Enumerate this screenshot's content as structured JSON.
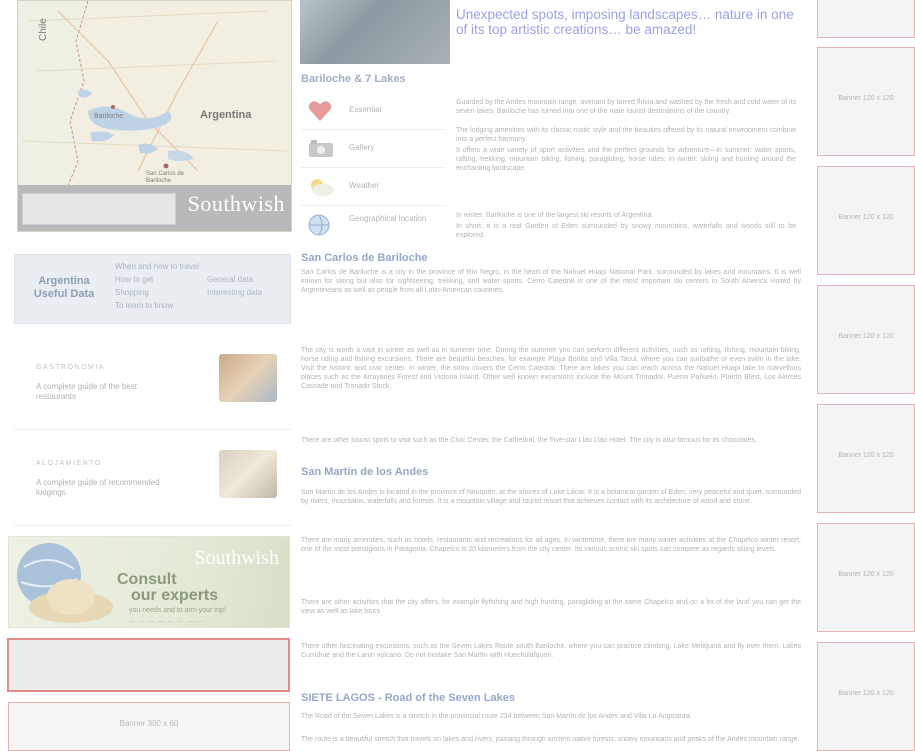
{
  "map": {
    "country_chile": "Chile",
    "country_argentina": "Argentina",
    "city_bariloche": "Bariloche",
    "city_san_carlos": "San Carlos de Bariloche",
    "logo": "Southwish"
  },
  "argentina_useful_data": {
    "title": "Argentina Useful Data",
    "links": [
      "When and how to travel",
      "General data",
      "How to get",
      "Shopping",
      "Interesting data",
      "To learn to know"
    ]
  },
  "promos": [
    {
      "title": "GASTRONOMIA",
      "description": "A complete guide of the best restaurants"
    },
    {
      "title": "ALOJAMIENTO",
      "description": "A complete guide of recommended lodgings"
    }
  ],
  "consult": {
    "logo": "Southwish",
    "line1": "Consult",
    "line2": "our experts",
    "tagline": "you needs and to arm your trip!",
    "sub": "— — — — — — — —"
  },
  "left_banner": {
    "text": "Banner 300 x 60"
  },
  "hero": {
    "text": "Unexpected spots, imposing landscapes… nature in one of its top artistic creations… be amazed!"
  },
  "bariloche": {
    "heading": "Bariloche & 7 Lakes",
    "icon_rows": [
      {
        "icon": "heart-icon",
        "label": "Essential"
      },
      {
        "icon": "camera-icon",
        "label": "Gallery"
      },
      {
        "icon": "cloud-icon",
        "label": "Weather"
      },
      {
        "icon": "globe-icon",
        "label": "Geographical location"
      }
    ],
    "paragraphs": [
      "Guarded by the Andes mountain range, avenant by tarred fluvia and washed by the fresh and cold water of its seven lakes, Bariloche has turned into one of the main tourist destinations of the country.",
      "The lodging amenities with its classic rustic style and the beauties offered by its natural environment combine into a perfect harmony.",
      "It offers a wide variety of sport activities and the perfect grounds for adventure—in summer: water sports, rafting, trekking, mountain biking, fishing, paragliding, horse rides; in winter: skiing and hunting around the enchanting landscape.",
      "In winter, Bariloche is one of the largest ski resorts of Argentina.",
      "In short: it is a real Garden of Eden surrounded by snowy mountains, waterfalls and woods still to be explored."
    ]
  },
  "san_carlos": {
    "heading": "San Carlos de Bariloche",
    "paragraphs": [
      "San Carlos de Bariloche is a city in the province of Río Negro, in the heart of the Nahuel Huapi National Park, surrounded by lakes and mountains. It is well known for skiing but also for sightseeing, trekking, and water sports. Cerro Catedral is one of the most important ski centers in South America visited by Argentineans as well as people from all Latin-American countries.",
      "The city is worth a visit in winter as well as in summer time. During the summer you can perform different activities, such as rafting, fishing, mountain biking, horse riding and fishing excursions. There are beautiful beaches, for example Playa Bonita and Villa Tacul, where you can sunbathe or even swim in the lake. Visit the historic and civic center. In winter, the snow covers the Cerro Catedral. There are lakes you can reach across the Nahuel Huapi lake to marvellous places such as the Arrayanes Forest and Victoria Island. Other well known excursions include the Mount Tronador, Puerto Pañuelo, Puerto Blest, Los Alerces Cascade and Tronadir Stock.",
      "There are other tourist spots to visit such as the Civic Center, the Cathedral, the Five-star Llao Llao Hotel. The city is also famous for its chocolates."
    ]
  },
  "san_martin": {
    "heading": "San Martín de los Andes",
    "paragraphs": [
      "San Martín de los Andes is located in the province of Neuquén, at the shores of Lake Lácar. It is a botanical garden of Eden, very peaceful and quiet, surrounded by rivers, mountains, waterfalls and forests. It is a mountain village and tourist resort that achieves contact with its architecture of wood and stone.",
      "There are many amenities, such as hotels, restaurants and recreations for all ages.\nIn wintertime, there are many winter activities at the Chapelco winter resort, one of the most prestigious in Patagonia. Chapelco is 20 kilometers from the city center. Its various scenic ski spots can compete as regards skiing levels.",
      "There are other activities that the city offers, for example flyfishing and high hunting, paragliding at the same Chapelco and on a lot of the land you can get the view as well as lake tours.",
      "There other fascinating excursions, such as the Seven Lakes Route south Bariloche, where you can practice climbing, Lake Meliquina and fly over them, Lakes Curruhué and the Lanín volcano. Do not mistake San Martín with Huechulafquen."
    ]
  },
  "siete_lagos": {
    "heading": "SIETE LAGOS - Road of the Seven Lakes",
    "paragraphs": [
      "The Road of the Seven Lakes is a stretch in the provincial route 234 between San Martín de los Andes and Villa La Angostura.",
      "The route is a beautiful stretch that travels on lakes and rivers, passing through ancient native forests, snowy mountains and peaks of the Andes mountain range."
    ]
  },
  "right_banners": [
    {
      "text": "Banner 120 x 120"
    },
    {
      "text": "Banner 120 x 120"
    },
    {
      "text": "Banner 120 x 120"
    },
    {
      "text": "Banner 120 x 120"
    },
    {
      "text": "Banner 120 x 120"
    },
    {
      "text": "Banner 120 x 120"
    }
  ],
  "colors": {
    "banner_border": "#e5b5b5",
    "heading_blue": "#93a8c8",
    "hero_text": "#9aa3e0"
  }
}
